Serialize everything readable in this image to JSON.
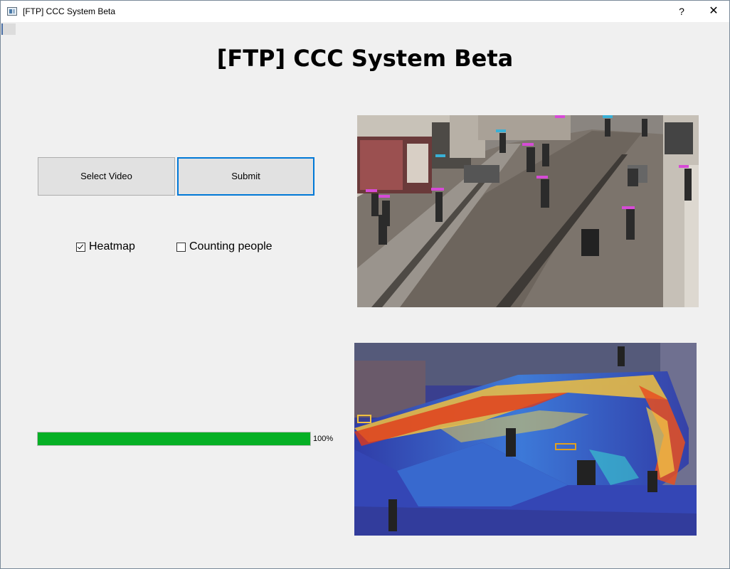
{
  "window": {
    "title": "[FTP] CCC System Beta",
    "help_label": "?",
    "close_label": "✕"
  },
  "main": {
    "heading": "[FTP] CCC System Beta",
    "select_video_label": "Select Video",
    "submit_label": "Submit",
    "options": {
      "heatmap": {
        "label": "Heatmap",
        "checked": true
      },
      "counting": {
        "label": "Counting people",
        "checked": false
      }
    },
    "progress": {
      "value": 100,
      "text": "100%"
    }
  },
  "colors": {
    "progress_fill": "#06b025",
    "focus_border": "#0078d7"
  },
  "icons": {
    "app": "app-window-icon",
    "help": "question-mark-icon",
    "close": "close-icon"
  }
}
